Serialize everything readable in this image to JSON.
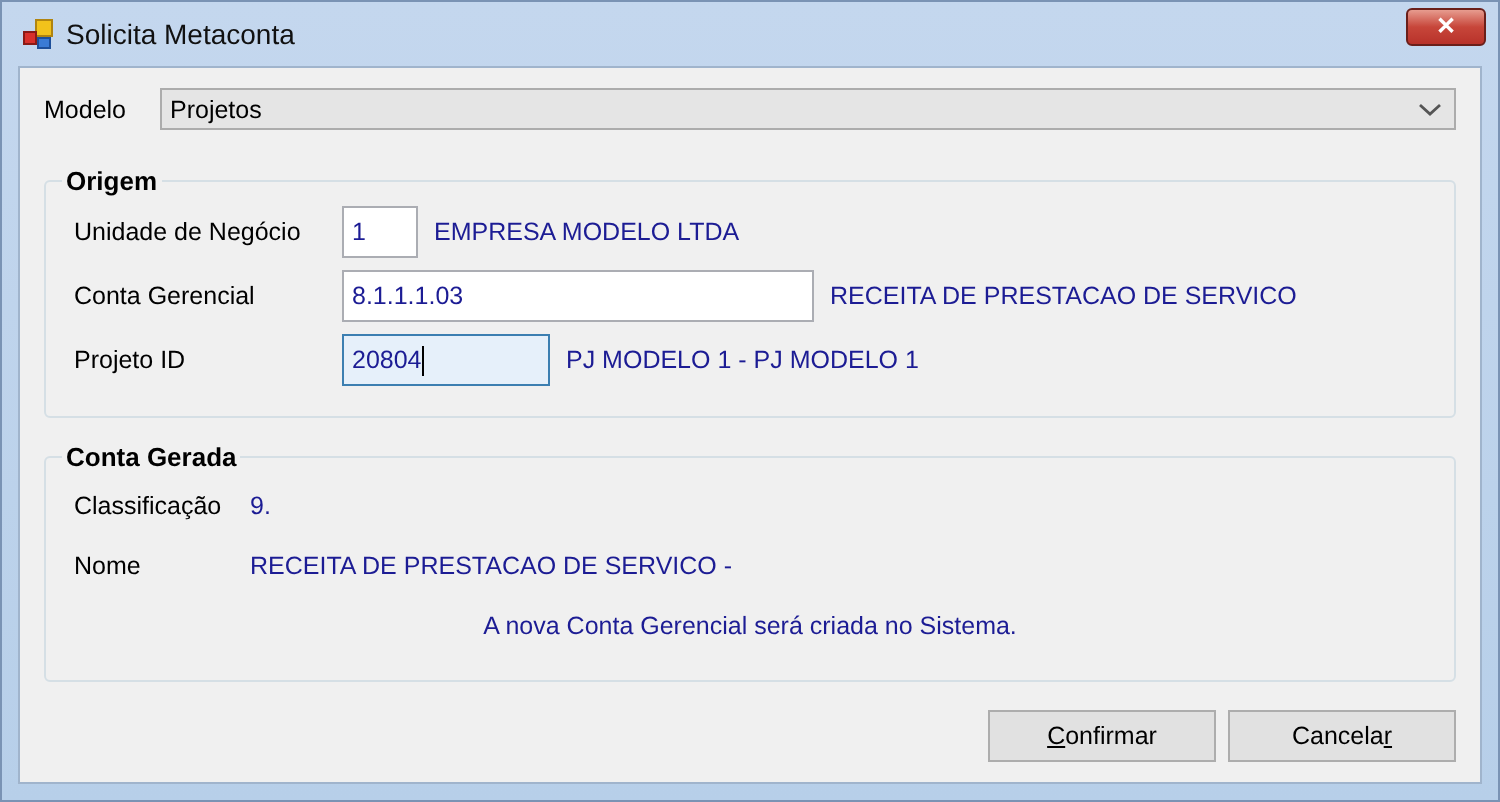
{
  "window": {
    "title": "Solicita Metaconta",
    "close": "✕"
  },
  "modelo": {
    "label": "Modelo",
    "value": "Projetos"
  },
  "origem": {
    "title": "Origem",
    "fields": [
      {
        "label": "Unidade de Negócio",
        "value": "1",
        "description": "EMPRESA MODELO LTDA",
        "kind": "short",
        "focused": false
      },
      {
        "label": "Conta Gerencial",
        "value": "8.1.1.1.03",
        "description": "RECEITA DE PRESTACAO DE SERVICO",
        "kind": "long",
        "focused": false
      },
      {
        "label": "Projeto ID",
        "value": "20804",
        "description": "PJ MODELO 1 - PJ MODELO 1",
        "kind": "medium",
        "focused": true
      }
    ]
  },
  "conta_gerada": {
    "title": "Conta Gerada",
    "rows": [
      {
        "label": "Classificação",
        "value": "9."
      },
      {
        "label": "Nome",
        "value": "RECEITA DE PRESTACAO DE SERVICO -"
      }
    ],
    "message": "A nova Conta Gerencial será criada no Sistema."
  },
  "buttons": [
    {
      "key": "C",
      "after": "onfirmar"
    },
    {
      "before": "Cancela",
      "key": "r"
    }
  ]
}
